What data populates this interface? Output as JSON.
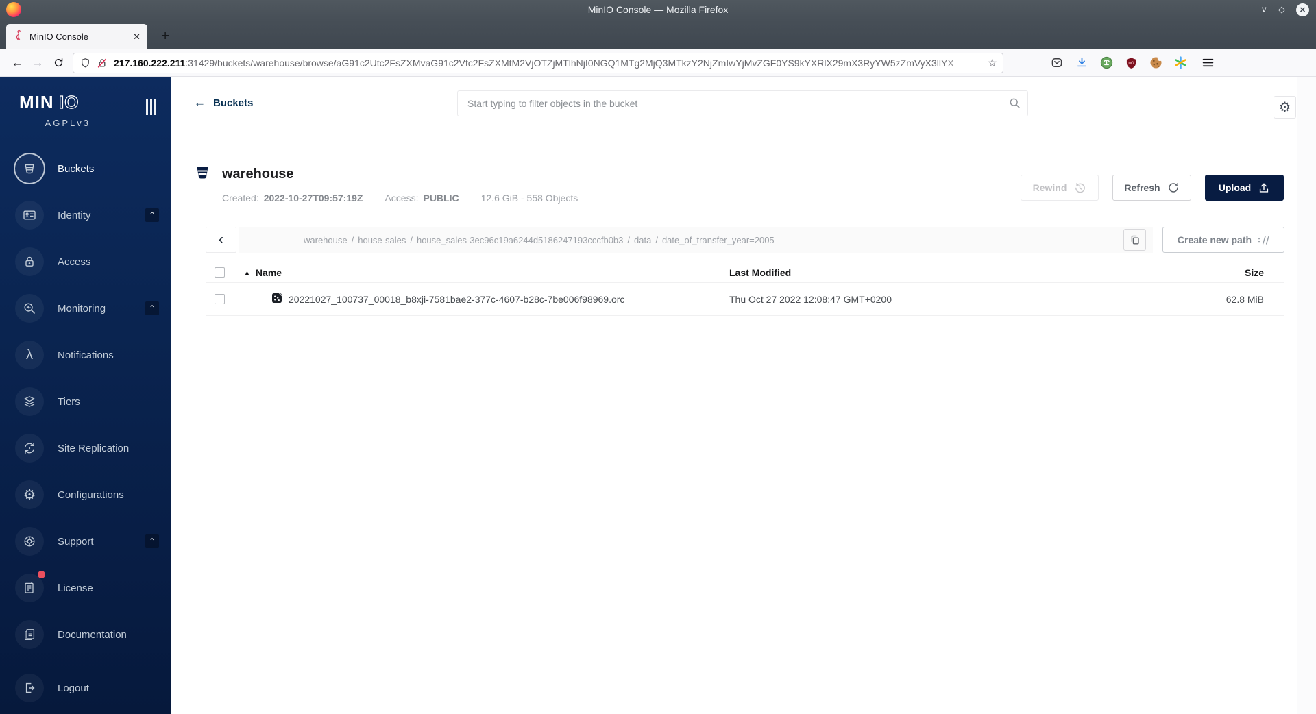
{
  "browser": {
    "window_title": "MinIO Console — Mozilla Firefox",
    "tab_title": "MinIO Console",
    "url_host": "217.160.222.211",
    "url_rest": ":31429/buckets/warehouse/browse/aG91c2Utc2FsZXMvaG91c2Vfc2FsZXMtM2VjOTZjMTlhNjI0NGQ1MTg2MjQ3MTkzY2NjZmIwYjMvZGF0YS9kYXRlX29mX3RyYW5zZmVyX3llYX",
    "glyphs": {
      "minimize": "∨",
      "maximize": "◇",
      "close": "✕",
      "tab_close": "✕",
      "new_tab": "+",
      "back": "←",
      "forward": "→",
      "star": "☆"
    }
  },
  "sidebar": {
    "logo_solid": "MIN",
    "logo_outline": "IO",
    "license_tag": "AGPLv3",
    "items": [
      {
        "label": "Buckets",
        "active": true
      },
      {
        "label": "Identity",
        "expandable": true
      },
      {
        "label": "Access"
      },
      {
        "label": "Monitoring",
        "expandable": true
      },
      {
        "label": "Notifications"
      },
      {
        "label": "Tiers"
      },
      {
        "label": "Site Replication"
      },
      {
        "label": "Configurations"
      },
      {
        "label": "Support",
        "expandable": true
      },
      {
        "label": "License",
        "badge": true
      },
      {
        "label": "Documentation"
      },
      {
        "label": "Logout"
      }
    ],
    "caret_glyph": "⌃",
    "lambda_glyph": "λ",
    "gear_glyph": "⚙"
  },
  "header": {
    "back_label": "Buckets",
    "search_placeholder": "Start typing to filter objects in the bucket",
    "gear_glyph": "⚙"
  },
  "bucket": {
    "name": "warehouse",
    "created_label": "Created:",
    "created_value": "2022-10-27T09:57:19Z",
    "access_label": "Access:",
    "access_value": "PUBLIC",
    "summary": "12.6 GiB - 558 Objects",
    "rewind_label": "Rewind",
    "refresh_label": "Refresh",
    "upload_label": "Upload"
  },
  "browse": {
    "back_glyph": "‹",
    "separator": "/",
    "segments": [
      "warehouse",
      "house-sales",
      "house_sales-3ec96c19a6244d5186247193cccfb0b3",
      "data",
      "date_of_transfer_year=2005"
    ],
    "create_path_label": "Create new path"
  },
  "table": {
    "sort_glyph": "▲",
    "columns": [
      "Name",
      "Last Modified",
      "Size"
    ],
    "rows": [
      {
        "name": "20221027_100737_00018_b8xji-7581bae2-377c-4607-b28c-7be006f98969.orc",
        "last_modified": "Thu Oct 27 2022 12:08:47 GMT+0200",
        "size": "62.8 MiB"
      }
    ]
  },
  "colors": {
    "sidebar_navy": "#081C42",
    "accent_navy": "#073052",
    "badge_red": "#ea4f5e",
    "download_blue": "#3584e4"
  }
}
